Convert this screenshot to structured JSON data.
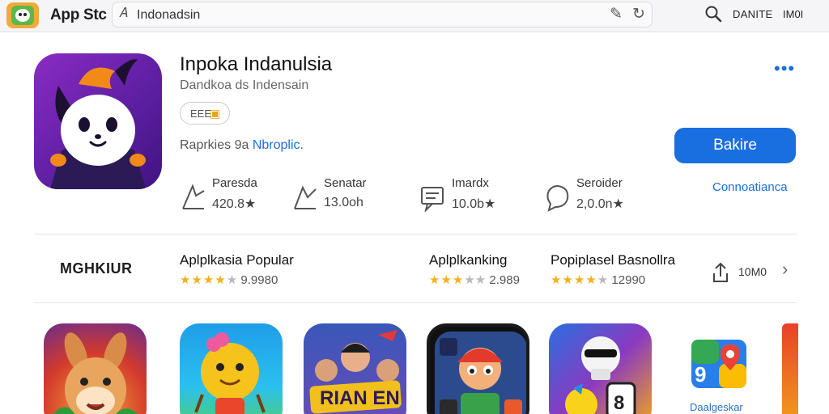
{
  "window": {
    "store_title": "App Stc",
    "url": "Indonadsin",
    "nav_link_1": "DANITE",
    "nav_link_2": "IM0I"
  },
  "app": {
    "name": "Inpoka Indanulsia",
    "subtitle": "Dandkoa ds Indensain",
    "badge_text": "EEE",
    "developer_label": "Raprkies 9a",
    "developer_link": "Nbroplic.",
    "primary_button": "Bakire",
    "secondary_link": "Connoatianca",
    "more_icon": "more-dots-icon"
  },
  "stats": [
    {
      "label": "Paresda",
      "value": "420.8★",
      "icon": "chart-icon"
    },
    {
      "label": "Senatar",
      "value": "13.0oh",
      "icon": "chart-icon"
    },
    {
      "label": "Imardx",
      "value": "10.0b★",
      "icon": "chat-icon"
    },
    {
      "label": "Seroider",
      "value": "2,0.0n★",
      "icon": "speech-icon"
    }
  ],
  "categories": {
    "heading": "MGHKIUR",
    "items": [
      {
        "title": "Aplplkasia Popular",
        "stars_filled": 4,
        "stars_total": 5,
        "count": "9.9980"
      },
      {
        "title": "Aplplkanking",
        "stars_filled": 3,
        "stars_total": 5,
        "count": "2.989"
      },
      {
        "title": "Popiplasel Basnollra",
        "stars_filled": 4,
        "stars_total": 5,
        "count": "12990"
      }
    ],
    "share_label": "10M0",
    "share_icon": "share-icon",
    "chevron_icon": "chevron-right-icon"
  },
  "apps_row": {
    "last_label": "Daalgeskar"
  },
  "colors": {
    "accent": "#1a6fe0",
    "star": "#f2b01e",
    "app_icon_bg": "#6a22b2"
  }
}
